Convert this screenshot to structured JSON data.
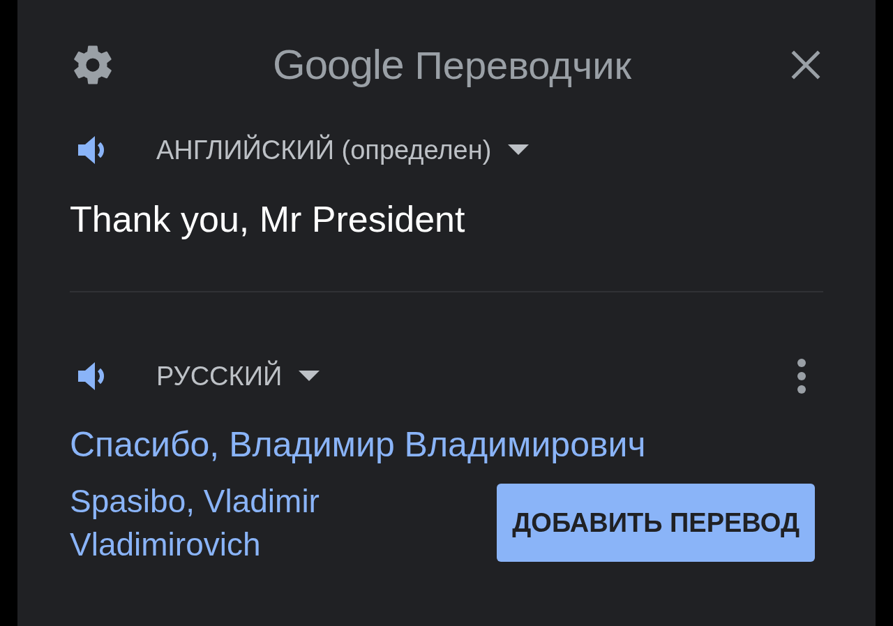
{
  "header": {
    "logo": "Google",
    "title": "Переводчик"
  },
  "source": {
    "language": "АНГЛИЙСКИЙ (определен)",
    "text": "Thank you, Mr President"
  },
  "target": {
    "language": "РУССКИЙ",
    "text": "Спасибо, Владимир Владимирович",
    "transliteration": "Spasibo, Vladimir Vladimirovich"
  },
  "action_button": "ДОБАВИТЬ ПЕРЕВОД"
}
